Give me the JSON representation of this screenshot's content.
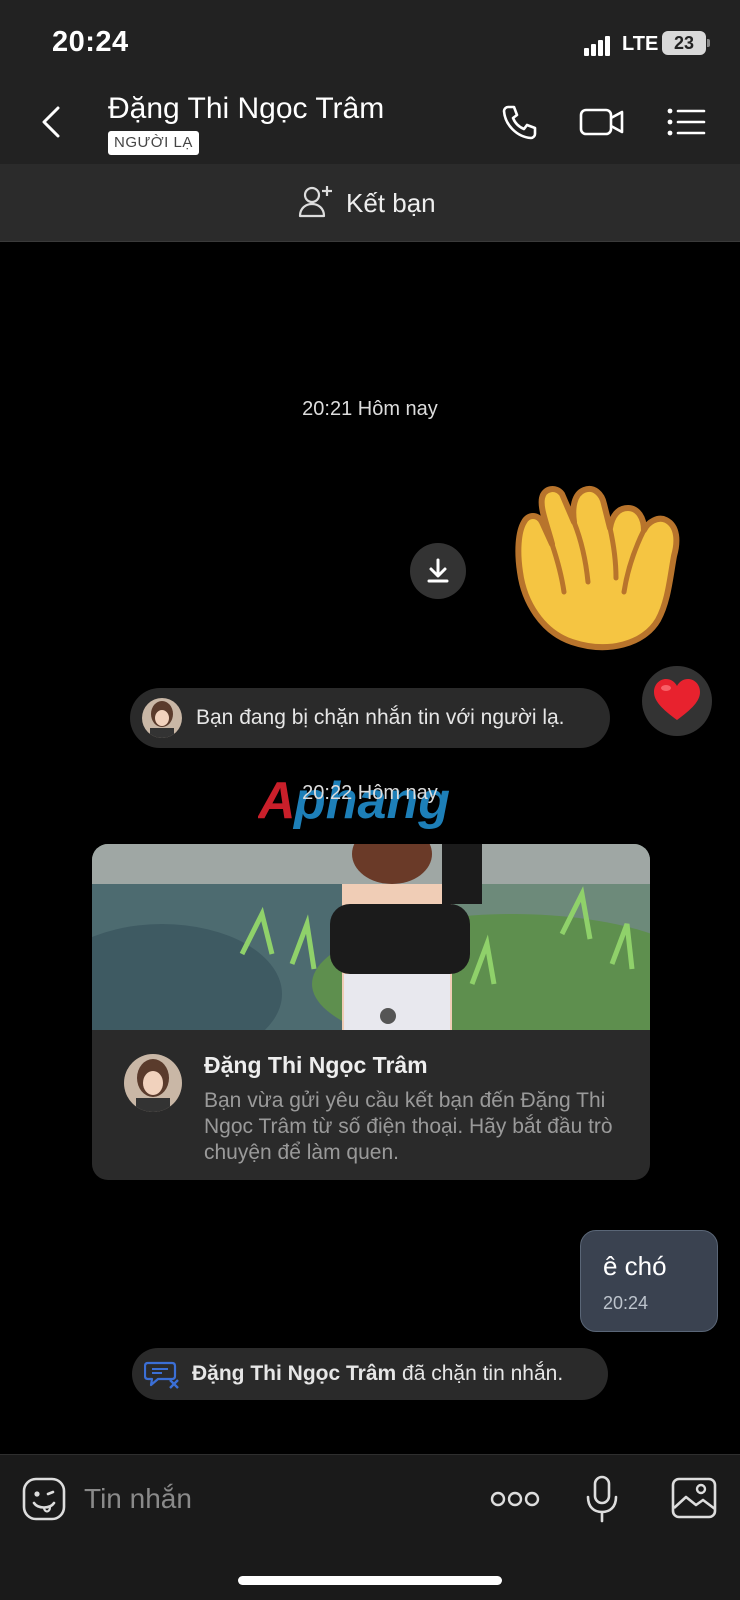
{
  "status_bar": {
    "time": "20:24",
    "network": "LTE",
    "battery": "23"
  },
  "header": {
    "name": "Đặng Thi Ngọc Trâm",
    "tag": "NGƯỜI LẠ",
    "icons": [
      "back-icon",
      "phone-icon",
      "video-call-icon",
      "menu-list-icon"
    ]
  },
  "friend_bar": {
    "label": "Kết bạn",
    "icon": "add-user-icon"
  },
  "chat": {
    "timestamp1": "20:21 Hôm nay",
    "notice_text": "Bạn đang bị chặn nhắn tin với người lạ.",
    "watermark": "Aphang",
    "timestamp2": "20:22 Hôm nay",
    "card": {
      "name": "Đặng Thi Ngọc Trâm",
      "description": "Bạn vừa gửi yêu cầu kết bạn đến Đặng Thi Ngọc Trâm từ số điện thoại. Hãy bắt đầu trò chuyện để làm quen."
    },
    "outgoing": {
      "text": "ê chó",
      "time": "20:24"
    },
    "blocked": {
      "name": "Đặng Thi Ngọc Trâm",
      "suffix": " đã chặn tin nhắn."
    }
  },
  "input_bar": {
    "placeholder": "Tin nhắn",
    "icons": [
      "sticker-icon",
      "more-icon",
      "microphone-icon",
      "gallery-icon"
    ]
  },
  "colors": {
    "header_bg": "#222222",
    "friend_bar_bg": "#2b2b2b",
    "bubble_out_bg": "#3a4250",
    "pill_bg": "#2a2a2a",
    "blocked_icon": "#3b6fd6"
  }
}
